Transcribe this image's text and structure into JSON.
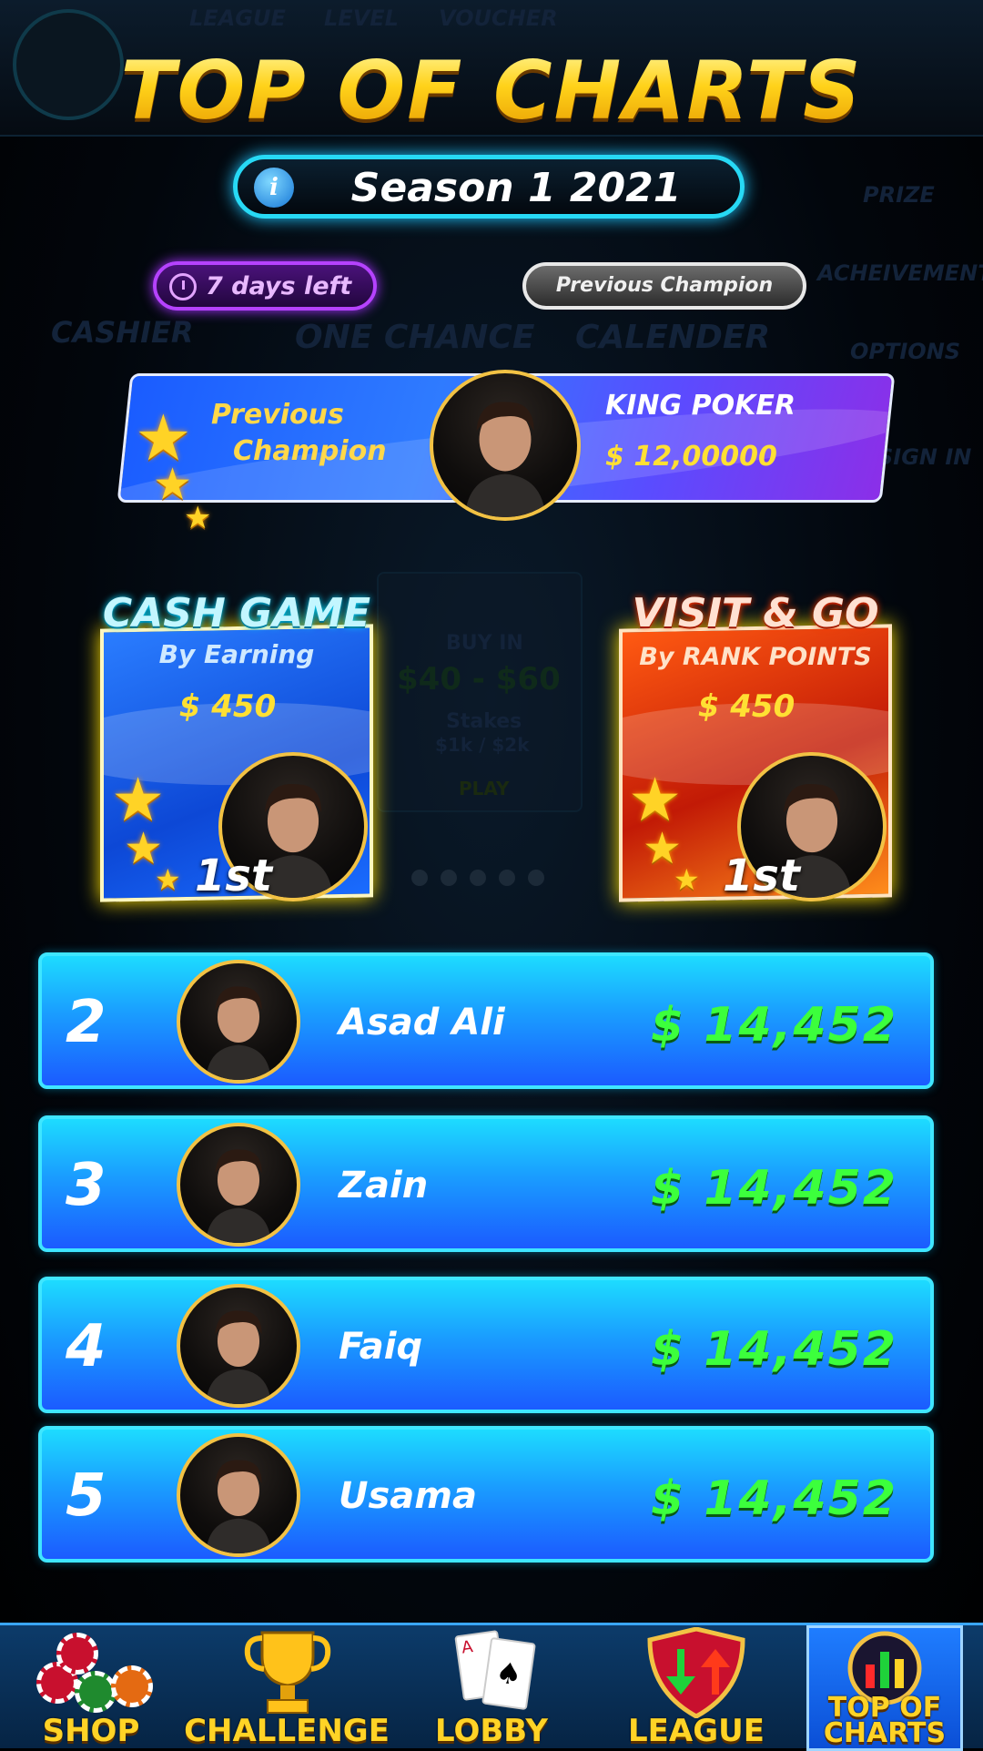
{
  "background": {
    "top_tabs": [
      "LEAGUE",
      "LEVEL",
      "VOUCHER"
    ],
    "side_menu": [
      "PRIZE",
      "ACHEIVEMENTS",
      "OPTIONS",
      "SIGN IN"
    ],
    "tiles": [
      "CASHIER",
      "ONE CHANCE",
      "CALENDER"
    ],
    "stake_card": {
      "title": "BUY IN",
      "range": "$40 - $60",
      "stakes_label": "Stakes",
      "stakes_value": "$1k / $2k",
      "play": "PLAY"
    }
  },
  "header": {
    "title": "TOP OF CHARTS",
    "season": "Season 1 2021",
    "info_icon": "i",
    "days_left": "7 days left",
    "previous_champion_button": "Previous Champion"
  },
  "champion_banner": {
    "label_line1": "Previous",
    "label_line2": "Champion",
    "name": "KING POKER",
    "amount": "$ 12,00000"
  },
  "categories": [
    {
      "title": "CASH GAME",
      "subtitle": "By Earning",
      "amount": "$ 450",
      "rank": "1st"
    },
    {
      "title": "VISIT & GO",
      "subtitle": "By RANK POINTS",
      "amount": "$ 450",
      "rank": "1st"
    }
  ],
  "leaderboard": [
    {
      "rank": "2",
      "name": "Asad Ali",
      "amount": "$ 14,452"
    },
    {
      "rank": "3",
      "name": "Zain",
      "amount": "$ 14,452"
    },
    {
      "rank": "4",
      "name": "Faiq",
      "amount": "$ 14,452"
    },
    {
      "rank": "5",
      "name": "Usama",
      "amount": "$ 14,452"
    }
  ],
  "nav": {
    "items": [
      "SHOP",
      "CHALLENGE",
      "LOBBY",
      "LEAGUE",
      "TOP OF CHARTS"
    ],
    "active": "TOP OF CHARTS"
  },
  "colors": {
    "title_gold": "#ffd21a",
    "season_border": "#27d9f5",
    "days_purple": "#b542ff",
    "row_blue": "#1a9cff",
    "amount_green": "#3cff3c",
    "nav_label": "#ffd326"
  }
}
